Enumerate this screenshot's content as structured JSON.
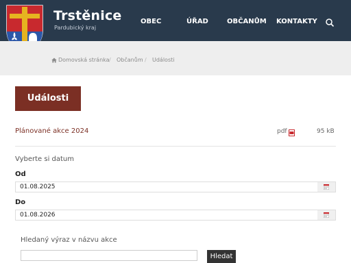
{
  "header": {
    "title": "Trstěnice",
    "subtitle": "Pardubický kraj",
    "nav": [
      {
        "label": "OBEC"
      },
      {
        "label": "ÚŘAD"
      },
      {
        "label": "OBČANŮM"
      },
      {
        "label": "KONTAKTY"
      }
    ],
    "search_icon": "search-icon",
    "colors": {
      "bar": "#293a4c",
      "crest_blue": "#2c57a8",
      "crest_red": "#c8292e",
      "crest_gold": "#e6b320"
    }
  },
  "breadcrumb": {
    "home_icon": "home-icon",
    "items": [
      "Domovská stránka",
      "Občanům",
      "Události"
    ],
    "separator": "/"
  },
  "page": {
    "heading": "Události",
    "heading_color": "#7b2f24"
  },
  "document": {
    "title": "Plánované akce 2024",
    "type": "pdf",
    "size": "95 kB",
    "icon": "pdf-icon"
  },
  "filter": {
    "prompt": "Vyberte si datum",
    "from_label": "Od",
    "from_value": "01.08.2025",
    "to_label": "Do",
    "to_value": "01.08.2026",
    "calendar_icon": "calendar-icon",
    "search_label": "Hledaný výraz v názvu akce",
    "search_value": "",
    "search_button": "Hledat"
  }
}
